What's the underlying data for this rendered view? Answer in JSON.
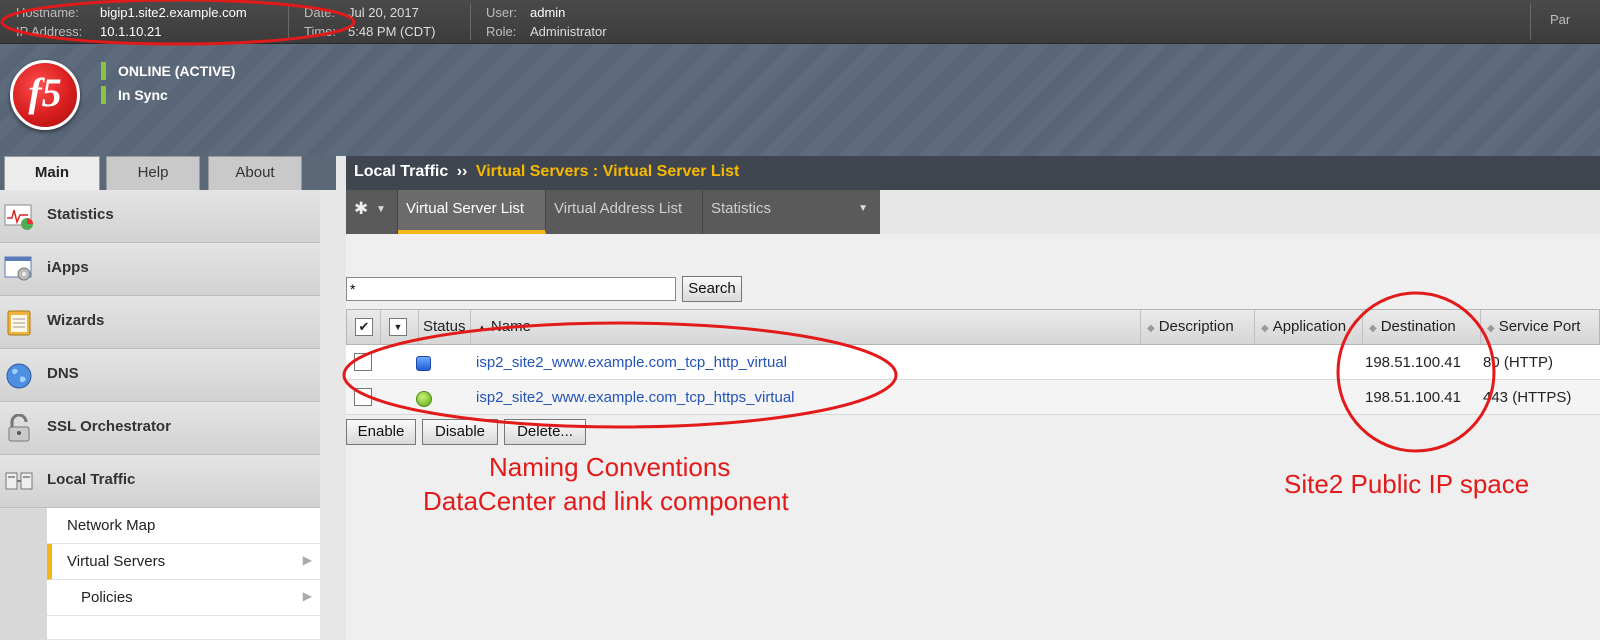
{
  "header": {
    "hostname_label": "Hostname:",
    "hostname": "bigip1.site2.example.com",
    "ip_label": "IP Address:",
    "ip": "10.1.10.21",
    "date_label": "Date:",
    "date": "Jul 20, 2017",
    "time_label": "Time:",
    "time": "5:48 PM (CDT)",
    "user_label": "User:",
    "user": "admin",
    "role_label": "Role:",
    "role": "Administrator",
    "partition_label": "Par"
  },
  "status": {
    "online": "ONLINE (ACTIVE)",
    "sync": "In Sync"
  },
  "logo_text": "f5",
  "tabs": [
    "Main",
    "Help",
    "About"
  ],
  "nav": {
    "items": [
      "Statistics",
      "iApps",
      "Wizards",
      "DNS",
      "SSL Orchestrator",
      "Local Traffic"
    ],
    "sub_items": [
      "Network Map",
      "Virtual Servers",
      "Policies"
    ]
  },
  "breadcrumb": {
    "section": "Local Traffic",
    "sep": "››",
    "page": "Virtual Servers : Virtual Server List"
  },
  "subnav": {
    "items": [
      "Virtual Server List",
      "Virtual Address List",
      "Statistics"
    ]
  },
  "search": {
    "value": "*",
    "button": "Search"
  },
  "table": {
    "columns": [
      "Status",
      "Name",
      "Description",
      "Application",
      "Destination",
      "Service Port"
    ],
    "rows": [
      {
        "status": "unknown",
        "name": "isp2_site2_www.example.com_tcp_http_virtual",
        "destination": "198.51.100.41",
        "port": "80 (HTTP)"
      },
      {
        "status": "available",
        "name": "isp2_site2_www.example.com_tcp_https_virtual",
        "destination": "198.51.100.41",
        "port": "443 (HTTPS)"
      }
    ]
  },
  "actions": [
    "Enable",
    "Disable",
    "Delete..."
  ],
  "annotations": {
    "naming_line1": "Naming Conventions",
    "naming_line2": "DataCenter and link component",
    "site2": "Site2 Public IP space"
  },
  "colors": {
    "annotation_red": "#e21a1a",
    "accent_yellow": "#f2b81a",
    "status_green": "#8bc53f",
    "link_blue": "#2253b8"
  }
}
